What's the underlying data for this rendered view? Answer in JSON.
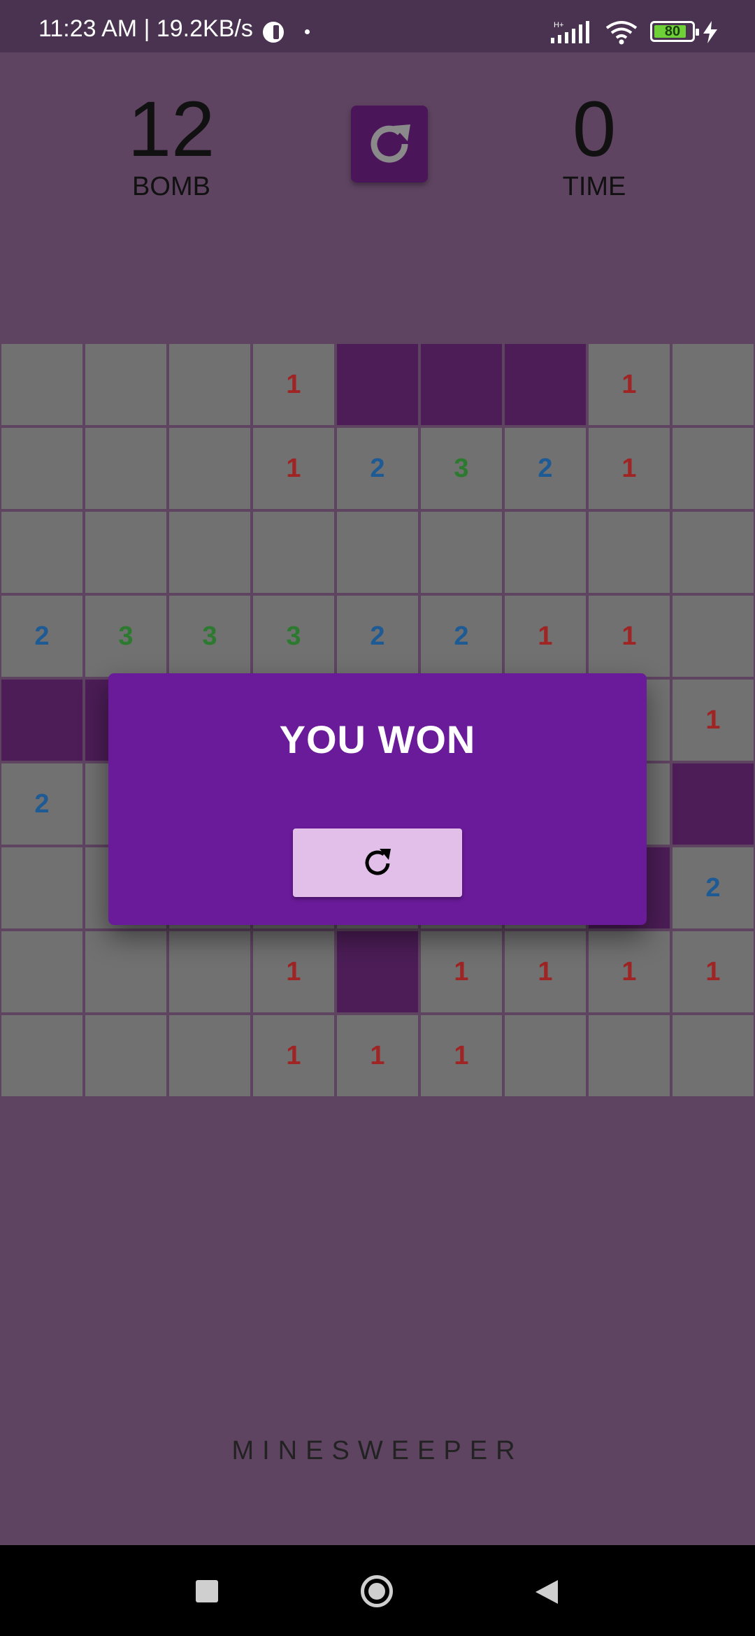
{
  "status_bar": {
    "time_speed": "11:23 AM | 19.2KB/s",
    "network_type": "H+",
    "battery_level": "80",
    "icons": [
      "vpn-icon",
      "signal-icon",
      "wifi-icon",
      "battery-icon",
      "charging-bolt-icon"
    ]
  },
  "header": {
    "bomb_count": "12",
    "bomb_label": "BOMB",
    "time_value": "0",
    "time_label": "TIME",
    "reset_icon": "refresh-icon"
  },
  "board": {
    "rows": 9,
    "cols": 9,
    "cells": [
      [
        "",
        "",
        "",
        "1",
        "#",
        "#",
        "#",
        "1",
        ""
      ],
      [
        "",
        "",
        "",
        "1",
        "2",
        "3",
        "2",
        "1",
        ""
      ],
      [
        "",
        "",
        "",
        "",
        "",
        "",
        "",
        "",
        ""
      ],
      [
        "2",
        "3",
        "3",
        "3",
        "2",
        "2",
        "1",
        "1",
        ""
      ],
      [
        "#",
        "#",
        "",
        "",
        "",
        "",
        "",
        "",
        "1"
      ],
      [
        "2",
        "",
        "",
        "",
        "",
        "",
        "",
        "",
        "#"
      ],
      [
        "",
        "",
        "",
        "",
        "",
        "",
        "",
        "#",
        "2"
      ],
      [
        "",
        "",
        "",
        "1",
        "#",
        "1",
        "1",
        "1",
        "1"
      ],
      [
        "",
        "",
        "",
        "1",
        "1",
        "1",
        "",
        "",
        ""
      ]
    ]
  },
  "dialog": {
    "title": "YOU WON",
    "restart_icon": "refresh-icon"
  },
  "footer": {
    "app_name": "MINESWEEPER"
  },
  "nav_bar": {
    "icons": [
      "recents-square-icon",
      "home-circle-icon",
      "back-triangle-icon"
    ]
  },
  "colors": {
    "background": "#5f4462",
    "status_bar": "#4a3350",
    "revealed_cell": "#717171",
    "closed_cell": "#4c1d57",
    "dialog": "#6a1b9a",
    "dialog_button": "#e2bfe8",
    "number_1": "#9f2424",
    "number_2": "#1e5a94",
    "number_3": "#2c7a30"
  }
}
